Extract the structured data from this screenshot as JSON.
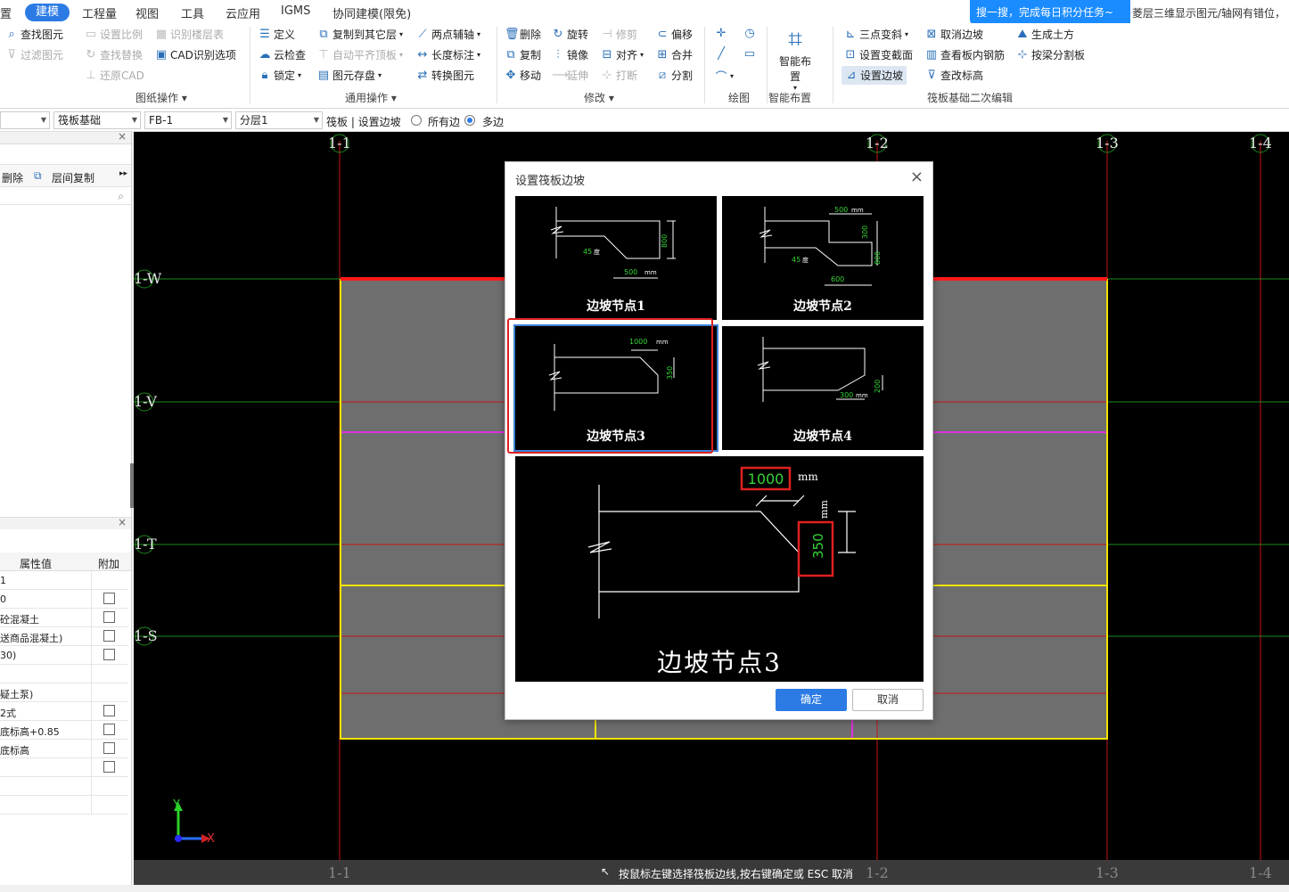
{
  "menu": {
    "items": [
      "置",
      "工程量",
      "视图",
      "工具",
      "云应用",
      "IGMS",
      "协同建模(限免)"
    ],
    "active": "建模"
  },
  "notice": {
    "text": "搜一搜，完成每日积分任务~",
    "right_text": "菱层三维显示图元/轴网有错位，"
  },
  "ribbon": {
    "drawing_ops": {
      "group": "图纸操作",
      "find_element": "查找图元",
      "filter_element": "过滤图元",
      "set_scale": "设置比例",
      "identify_floor_table": "识别楼层表",
      "find_replace": "查找替换",
      "cad_options": "CAD识别选项",
      "restore_cad": "还原CAD"
    },
    "general_ops": {
      "group": "通用操作",
      "define": "定义",
      "copy_to_layer": "复制到其它层",
      "two_point_axis": "两点辅轴",
      "cloud_check": "云检查",
      "auto_align_top": "自动平齐顶板",
      "length_dim": "长度标注",
      "lock": "锁定",
      "element_save": "图元存盘",
      "convert_element": "转换图元"
    },
    "modify": {
      "group": "修改",
      "delete": "删除",
      "rotate": "旋转",
      "trim": "修剪",
      "offset": "偏移",
      "copy": "复制",
      "mirror": "镜像",
      "align": "对齐",
      "merge": "合并",
      "move": "移动",
      "extend": "延伸",
      "break": "打断",
      "split": "分割"
    },
    "draw": {
      "group": "绘图"
    },
    "smart": {
      "group": "智能布置",
      "label": "智能布置"
    },
    "raft_edit": {
      "group": "筏板基础二次编辑",
      "three_point_slope": "三点变斜",
      "cancel_edge": "取消边坡",
      "gen_earthwork": "生成土方",
      "set_var_section": "设置变截面",
      "view_rebar": "查看板内钢筋",
      "split_by_beam": "按梁分割板",
      "set_edge": "设置边坡",
      "view_elevation": "查改标高"
    }
  },
  "toolbar2": {
    "combo_type": "筏板基础",
    "combo_name": "FB-1",
    "combo_layer": "分层1",
    "breadcrumb": "筏板 | 设置边坡",
    "radio_all": "所有边",
    "radio_multi": "多边"
  },
  "left_panel": {
    "delete": "删除",
    "layer_copy": "层间复制",
    "prop_header_value": "属性值",
    "prop_header_extra": "附加",
    "props": [
      "1",
      "0",
      "砼混凝土",
      "送商品混凝土)",
      "30)",
      "",
      "疑土泵)",
      "2式",
      "底标高+0.85",
      "底标高",
      "",
      "",
      ""
    ]
  },
  "canvas": {
    "axis_top": [
      "1-1",
      "1-2",
      "1-3",
      "1-4"
    ],
    "axis_left": [
      "1-W",
      "1-V",
      "1-T",
      "1-S"
    ],
    "axis_bottom": [
      "1-1",
      "1-2",
      "1-3",
      "1-4"
    ],
    "coord_x": "X",
    "coord_y": "Y"
  },
  "status": {
    "text": "按鼠标左键选择筏板边线,按右键确定或 ESC 取消"
  },
  "dialog": {
    "title": "设置筏板边坡",
    "options": [
      {
        "label": "边坡节点1",
        "dims": [
          "500",
          "mm",
          "800",
          "45",
          "度"
        ]
      },
      {
        "label": "边坡节点2",
        "dims": [
          "500",
          "mm",
          "300",
          "800",
          "600",
          "45",
          "度"
        ]
      },
      {
        "label": "边坡节点3",
        "dims": [
          "1000",
          "mm",
          "350"
        ]
      },
      {
        "label": "边坡节点4",
        "dims": [
          "300",
          "mm",
          "200"
        ]
      }
    ],
    "preview": {
      "label": "边坡节点3",
      "width_value": "1000",
      "width_unit": "mm",
      "height_value": "350",
      "height_unit": "mm"
    },
    "ok": "确定",
    "cancel": "取消"
  },
  "colors": {
    "accent": "#2c7be5",
    "canvas_bg": "#000000",
    "raft_fill": "#6e6e6e",
    "edge_yellow": "#f2e400",
    "grid_red": "#c81414",
    "highlight_red": "#e02020",
    "dim_green": "#35d435"
  }
}
